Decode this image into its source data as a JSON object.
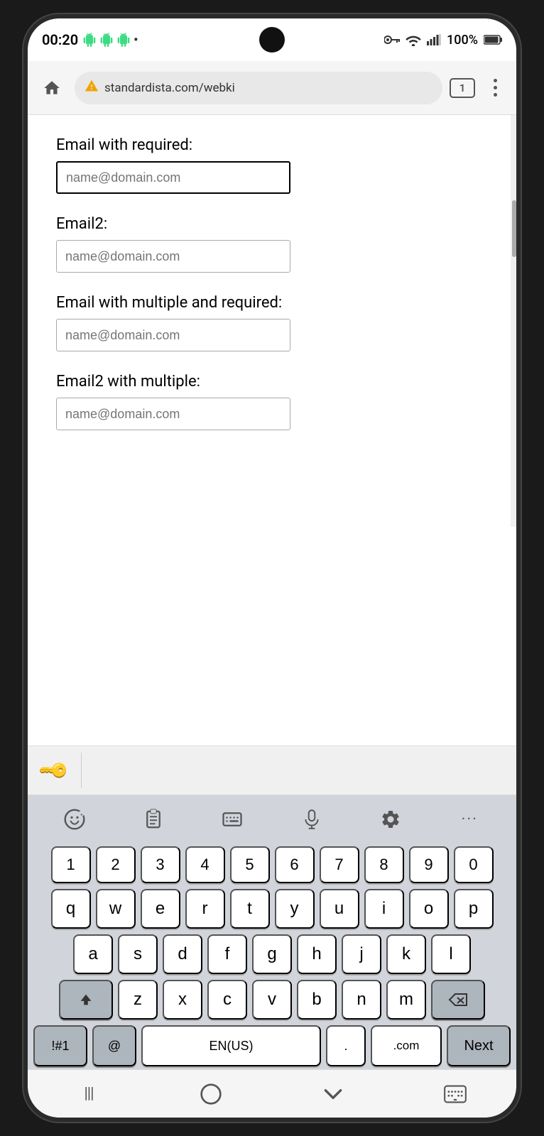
{
  "statusBar": {
    "time": "00:20",
    "battery": "100%",
    "dot": "•"
  },
  "browserBar": {
    "addressText": "standardista.com/webki",
    "tabCount": "1"
  },
  "form": {
    "field1": {
      "label": "Email with required:",
      "placeholder": "name@domain.com",
      "borderType": "active"
    },
    "field2": {
      "label": "Email2:",
      "placeholder": "name@domain.com",
      "borderType": "light"
    },
    "field3": {
      "label": "Email with multiple and required:",
      "placeholder": "name@domain.com",
      "borderType": "light"
    },
    "field4": {
      "label": "Email2 with multiple:",
      "placeholder": "name@domain.com",
      "borderType": "light"
    }
  },
  "keyboard": {
    "toolbar": {
      "emoji": "☺",
      "clipboard": "⊟",
      "keyboard": "⌨",
      "mic": "🎤",
      "settings": "⚙",
      "more": "···"
    },
    "numbers": [
      "1",
      "2",
      "3",
      "4",
      "5",
      "6",
      "7",
      "8",
      "9",
      "0"
    ],
    "row1": [
      "q",
      "w",
      "e",
      "r",
      "t",
      "y",
      "u",
      "i",
      "o",
      "p"
    ],
    "row2": [
      "a",
      "s",
      "d",
      "f",
      "g",
      "h",
      "j",
      "k",
      "l"
    ],
    "row3": [
      "z",
      "x",
      "c",
      "v",
      "b",
      "n",
      "m"
    ],
    "bottomBar": {
      "special": "!#1",
      "at": "@",
      "space": "EN(US)",
      "dot": ".",
      "dotcom": ".com",
      "next": "Next"
    }
  },
  "navBar": {
    "back": "|||",
    "home": "○",
    "down": "∨",
    "keyboard": "⊞"
  }
}
